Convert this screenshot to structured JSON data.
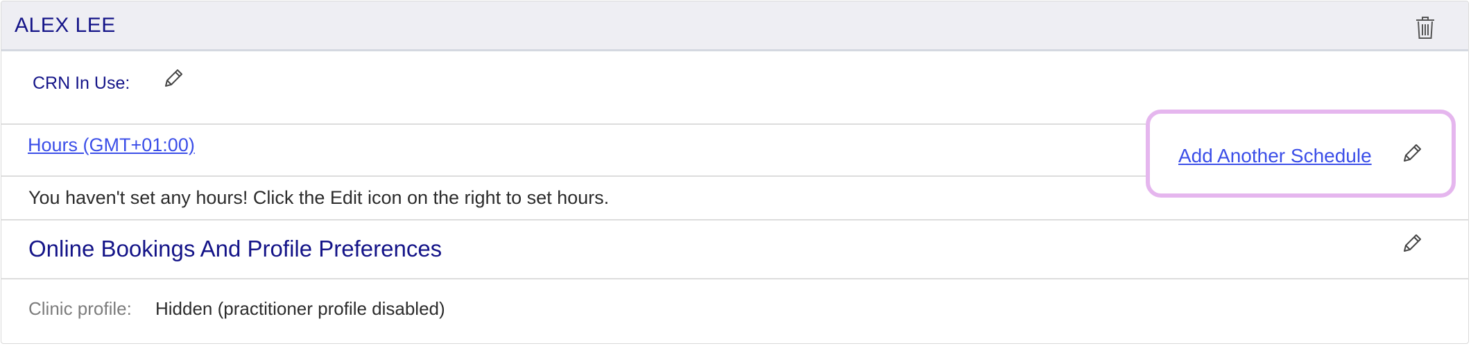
{
  "header": {
    "title": "ALEX LEE",
    "delete_icon": "trash-icon"
  },
  "crn": {
    "label": "CRN In Use:",
    "edit_icon": "pencil-icon"
  },
  "hours": {
    "link_label": "Hours (GMT+01:00)",
    "add_schedule_label": "Add Another Schedule",
    "edit_icon": "pencil-icon",
    "empty_notice": "You haven't set any hours! Click the Edit icon on the right to set hours."
  },
  "online_bookings": {
    "title": "Online Bookings And Profile Preferences",
    "edit_icon": "pencil-icon",
    "clinic_profile_label": "Clinic profile:",
    "clinic_profile_value": "Hidden (practitioner profile disabled)"
  },
  "colors": {
    "title_navy": "#141488",
    "link_blue": "#3b4ee8",
    "highlight": "#e5b6ee",
    "header_bg": "#eeeef3"
  }
}
